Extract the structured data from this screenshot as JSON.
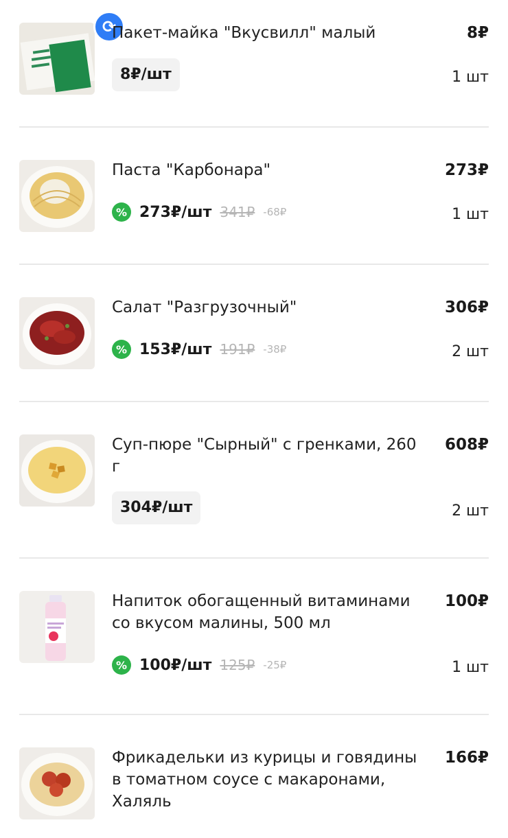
{
  "items": [
    {
      "name": "Пакет-майка \"Вкусвилл\" малый",
      "total": "8₽",
      "qty": "1 шт",
      "unit_price": "8₽/шт"
    },
    {
      "name": "Паста \"Карбонара\"",
      "total": "273₽",
      "qty": "1 шт",
      "unit_price": "273₽/шт",
      "old_price": "341₽",
      "saving": "-68₽"
    },
    {
      "name": "Салат \"Разгрузочный\"",
      "total": "306₽",
      "qty": "2 шт",
      "unit_price": "153₽/шт",
      "old_price": "191₽",
      "saving": "-38₽"
    },
    {
      "name": "Суп-пюре \"Сырный\" с гренками, 260 г",
      "total": "608₽",
      "qty": "2 шт",
      "unit_price": "304₽/шт"
    },
    {
      "name": "Напиток обогащенный витаминами со вкусом малины, 500 мл",
      "total": "100₽",
      "qty": "1 шт",
      "unit_price": "100₽/шт",
      "old_price": "125₽",
      "saving": "-25₽"
    },
    {
      "name": "Фрикадельки из курицы и говядины в томатном соусе с макаронами, Халяль",
      "total": "166₽"
    }
  ],
  "icons": {
    "swap": "swap-icon",
    "discount": "percent-icon"
  },
  "colors": {
    "discount_green": "#2db34a",
    "swap_blue": "#2f7df6"
  }
}
